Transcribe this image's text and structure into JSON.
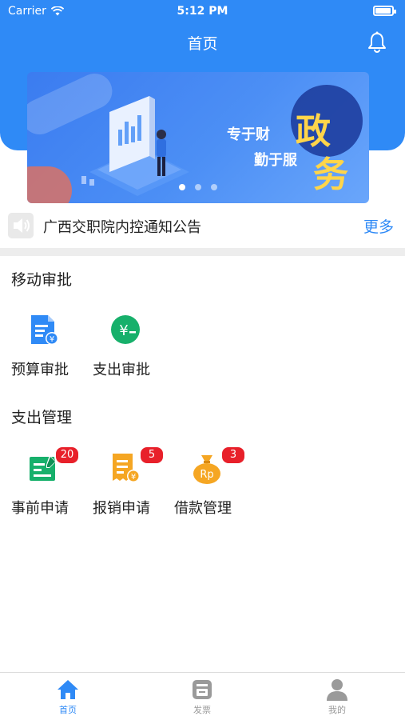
{
  "status_bar": {
    "carrier": "Carrier",
    "time": "5:12 PM"
  },
  "nav": {
    "title": "首页"
  },
  "banner": {
    "slogan_line1": "专于财",
    "slogan_line2": "勤于服",
    "big_char1": "政",
    "big_char2": "务",
    "dots": 3,
    "active_dot": 0
  },
  "notice": {
    "text": "广西交职院内控通知公告",
    "more_label": "更多"
  },
  "sections": [
    {
      "title": "移动审批",
      "items": [
        {
          "label": "预算审批",
          "icon": "budget-doc-icon",
          "badge": null
        },
        {
          "label": "支出审批",
          "icon": "yuan-circle-icon",
          "badge": null
        }
      ]
    },
    {
      "title": "支出管理",
      "items": [
        {
          "label": "事前申请",
          "icon": "prior-application-icon",
          "badge": "20"
        },
        {
          "label": "报销申请",
          "icon": "reimbursement-receipt-icon",
          "badge": "5"
        },
        {
          "label": "借款管理",
          "icon": "loan-bag-icon",
          "badge": "3"
        }
      ]
    }
  ],
  "tabbar": [
    {
      "label": "首页",
      "icon": "home-icon",
      "active": true
    },
    {
      "label": "发票",
      "icon": "invoice-icon",
      "active": false
    },
    {
      "label": "我的",
      "icon": "profile-icon",
      "active": false
    }
  ],
  "colors": {
    "primary": "#2f8af6",
    "badge": "#e8202a",
    "green": "#17b06b",
    "orange": "#f5a623",
    "tab_inactive": "#9a9a9a"
  }
}
